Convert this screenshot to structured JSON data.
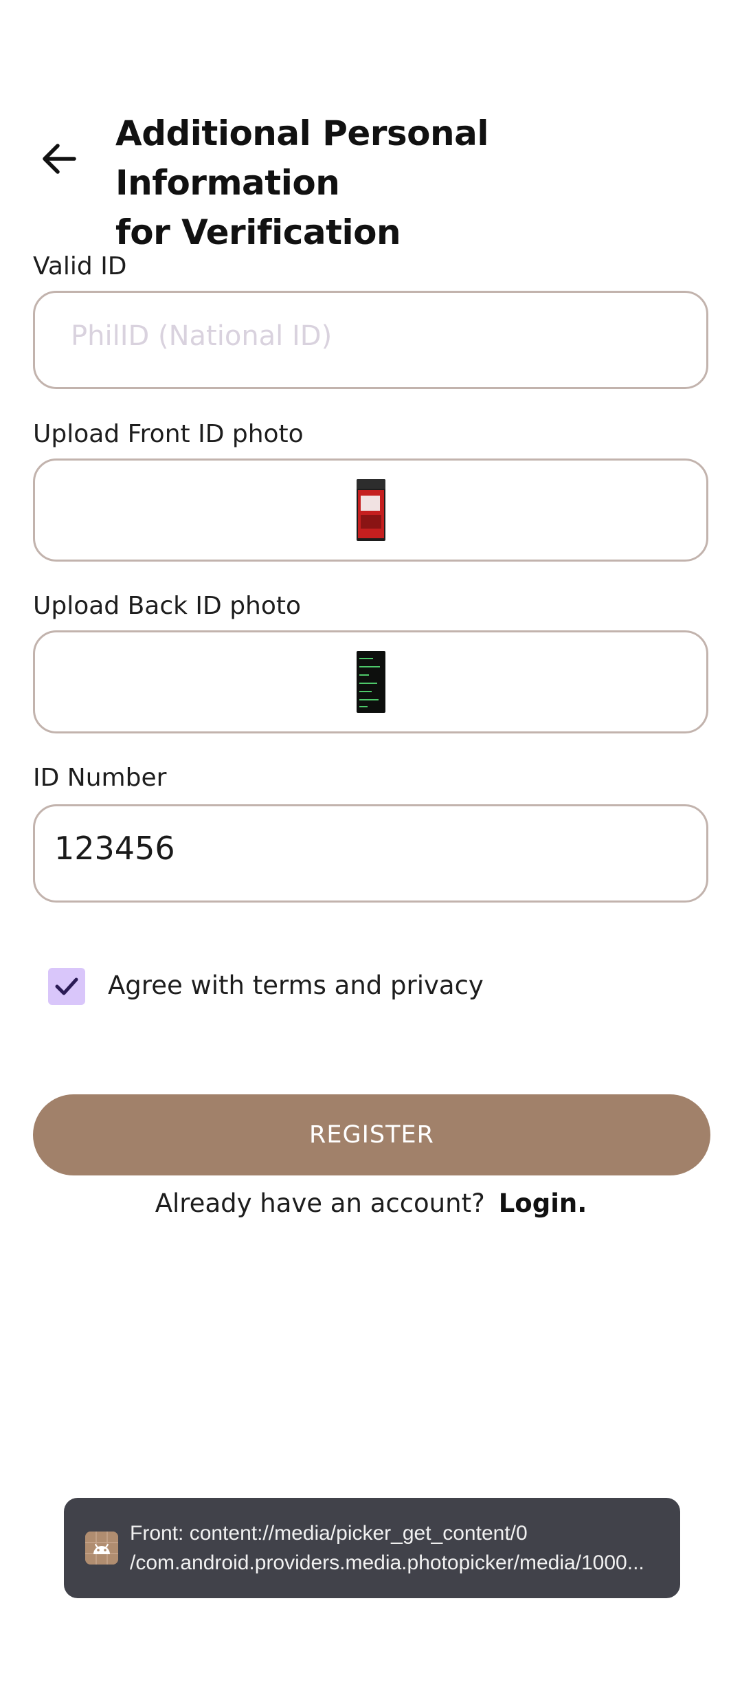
{
  "header": {
    "back_icon": "arrow-back-icon",
    "title_line1": "Additional Personal Information",
    "title_line2": "for Verification"
  },
  "form": {
    "valid_id": {
      "label": "Valid ID",
      "placeholder": "PhilID (National ID)"
    },
    "front_photo": {
      "label": "Upload Front ID photo"
    },
    "back_photo": {
      "label": "Upload Back ID photo"
    },
    "id_number": {
      "label": "ID Number",
      "value": "123456"
    },
    "terms": {
      "checked": true,
      "label": "Agree with terms and privacy"
    }
  },
  "actions": {
    "register_label": "REGISTER",
    "login_prompt": "Already have an account?",
    "login_link": "Login."
  },
  "toast": {
    "icon": "android-app-icon",
    "line1": "Front: content://media/picker_get_content/0",
    "line2": "/com.android.providers.media.photopicker/media/1000..."
  },
  "colors": {
    "accent": "#A1816A",
    "field_border": "#C2B3AD",
    "checkbox_fill": "#D9C6FA",
    "checkbox_check": "#2B1B55",
    "toast_bg": "#41424A"
  }
}
